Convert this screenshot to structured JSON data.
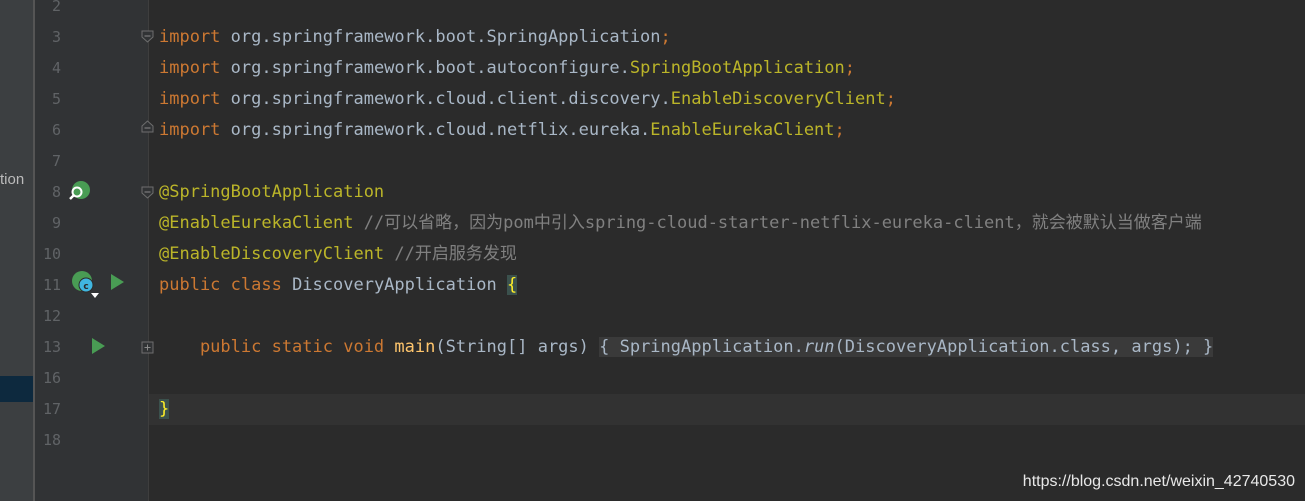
{
  "left_panel": {
    "cut_text": "tion"
  },
  "lines": [
    {
      "num": "2"
    },
    {
      "num": "3",
      "tokens": [
        [
          "kw",
          "import"
        ],
        [
          "pkg",
          " org.springframework.boot.SpringApplication"
        ],
        [
          "semi",
          ";"
        ]
      ]
    },
    {
      "num": "4",
      "tokens": [
        [
          "kw",
          "import"
        ],
        [
          "pkg",
          " org.springframework.boot.autoconfigure."
        ],
        [
          "unres",
          "SpringBootApplication"
        ],
        [
          "semi",
          ";"
        ]
      ]
    },
    {
      "num": "5",
      "tokens": [
        [
          "kw",
          "import"
        ],
        [
          "pkg",
          " org.springframework.cloud.client.discovery."
        ],
        [
          "unres",
          "EnableDiscoveryClient"
        ],
        [
          "semi",
          ";"
        ]
      ]
    },
    {
      "num": "6",
      "tokens": [
        [
          "kw",
          "import"
        ],
        [
          "pkg",
          " org.springframework.cloud.netflix.eureka."
        ],
        [
          "unres",
          "EnableEurekaClient"
        ],
        [
          "semi",
          ";"
        ]
      ]
    },
    {
      "num": "7"
    },
    {
      "num": "8",
      "tokens": [
        [
          "ann",
          "@SpringBootApplication"
        ]
      ]
    },
    {
      "num": "9",
      "tokens": [
        [
          "ann",
          "@EnableEurekaClient"
        ],
        [
          "cmt",
          " //可以省略，因为pom中引入spring-cloud-starter-netflix-eureka-client，就会被默认当做客户端"
        ]
      ]
    },
    {
      "num": "10",
      "tokens": [
        [
          "ann",
          "@EnableDiscoveryClient"
        ],
        [
          "cmt",
          " //开启服务发现"
        ]
      ]
    },
    {
      "num": "11",
      "tokens": [
        [
          "kw",
          "public class"
        ],
        [
          "cls",
          " DiscoveryApplication "
        ],
        [
          "brace-hl",
          "{"
        ]
      ]
    },
    {
      "num": "12"
    },
    {
      "num": "13",
      "tokens": [
        [
          "kw",
          "    public static void "
        ],
        [
          "fn",
          "main"
        ],
        [
          "cls",
          "(String[] args) "
        ],
        [
          "fold-box",
          "{ SpringApplication."
        ],
        [
          "fold-box it",
          "run"
        ],
        [
          "fold-box",
          "(DiscoveryApplication."
        ],
        [
          "fold-box kw",
          "class, "
        ],
        [
          "fold-box",
          "args)"
        ],
        [
          "fold-box semi",
          "; }"
        ]
      ]
    },
    {
      "num": "16"
    },
    {
      "num": "17",
      "tokens": [
        [
          "brace-hl",
          "}"
        ]
      ]
    },
    {
      "num": "18"
    }
  ],
  "gutter_icons": {
    "line8": "spring-bean-icon",
    "line11": "spring-class-icon",
    "run11": "run-icon",
    "run13": "run-icon"
  },
  "watermark": "https://blog.csdn.net/weixin_42740530"
}
